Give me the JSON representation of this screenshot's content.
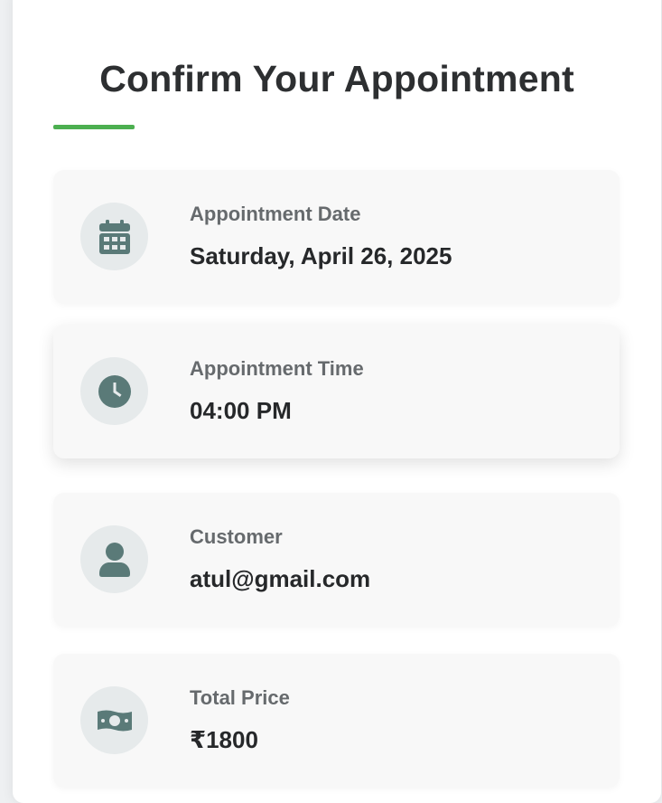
{
  "page": {
    "title": "Confirm Your Appointment"
  },
  "colors": {
    "accent": "#4caf50",
    "icon": "#5a7a78",
    "icon_bg": "#e6eaeb",
    "row_bg": "#f8f8f8"
  },
  "details": [
    {
      "icon": "calendar-icon",
      "label": "Appointment Date",
      "value": "Saturday, April 26, 2025"
    },
    {
      "icon": "clock-icon",
      "label": "Appointment Time",
      "value": "04:00 PM"
    },
    {
      "icon": "user-icon",
      "label": "Customer",
      "value": "atul@gmail.com"
    },
    {
      "icon": "money-bill-icon",
      "label": "Total Price",
      "value": "₹1800"
    }
  ]
}
